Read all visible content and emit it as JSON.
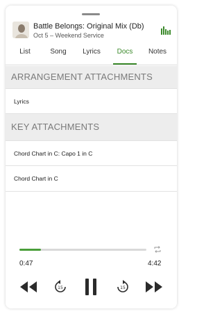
{
  "now_playing": {
    "title": "Battle Belongs: Original Mix (Db)",
    "subtitle": "Oct 5 – Weekend Service"
  },
  "tabs": [
    {
      "label": "List",
      "active": false
    },
    {
      "label": "Song",
      "active": false
    },
    {
      "label": "Lyrics",
      "active": false
    },
    {
      "label": "Docs",
      "active": true
    },
    {
      "label": "Notes",
      "active": false
    }
  ],
  "sections": {
    "arrangement": {
      "header": "ARRANGEMENT ATTACHMENTS",
      "items": [
        "Lyrics"
      ]
    },
    "key": {
      "header": "KEY ATTACHMENTS",
      "items": [
        "Chord Chart in C: Capo 1 in C",
        "Chord Chart in C"
      ]
    }
  },
  "player": {
    "elapsed": "0:47",
    "duration": "4:42",
    "progress": 0.167,
    "skip_back_seconds": "15",
    "skip_forward_seconds": "15"
  },
  "colors": {
    "accent": "#3c8a2c",
    "progress": "#4a9e3a",
    "section_bg": "#ededed",
    "control": "#2b2b2b"
  },
  "icons": [
    "grabber-handle",
    "album-art",
    "equalizer-icon",
    "loop-icon",
    "rewind-icon",
    "skip-back-15-icon",
    "pause-icon",
    "skip-forward-15-icon",
    "fast-forward-icon"
  ]
}
